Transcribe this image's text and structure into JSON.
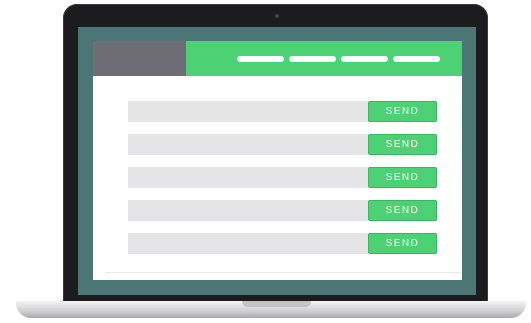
{
  "colors": {
    "screen_background": "#4c7576",
    "header_accent": "#4cd174",
    "logo_block": "#6e6c75",
    "field_background": "#e4e4e6",
    "device_frame": "#1c1c1e"
  },
  "header": {
    "nav_item_count": 4
  },
  "form_rows": [
    {
      "field_value": "",
      "button_label": "SEND"
    },
    {
      "field_value": "",
      "button_label": "SEND"
    },
    {
      "field_value": "",
      "button_label": "SEND"
    },
    {
      "field_value": "",
      "button_label": "SEND"
    },
    {
      "field_value": "",
      "button_label": "SEND"
    }
  ]
}
